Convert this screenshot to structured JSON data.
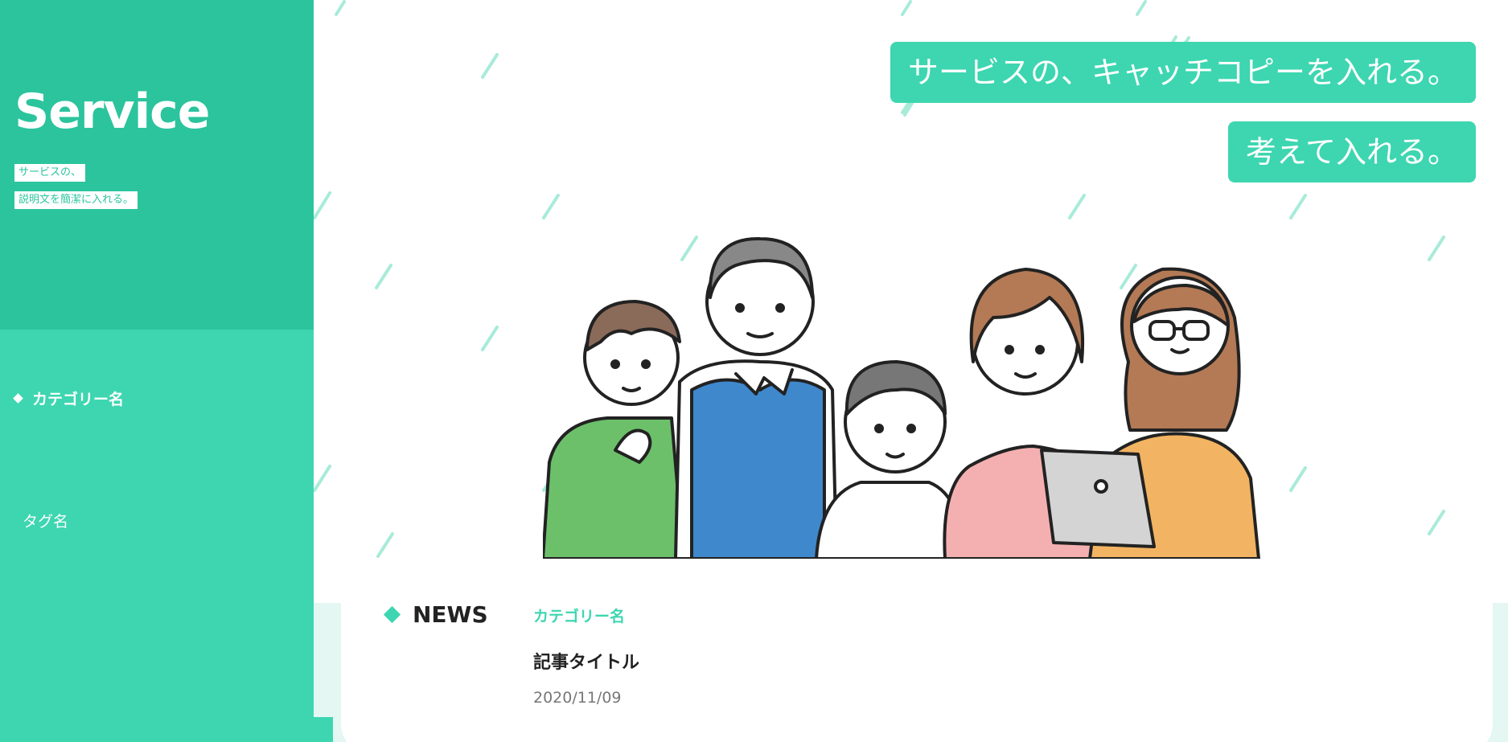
{
  "sidebar": {
    "brand": "Service",
    "description_lines": [
      "サービスの、",
      "説明文を簡潔に入れる。"
    ],
    "category_label": "カテゴリー名",
    "tag_label": "タグ名"
  },
  "hero": {
    "catch_lines": [
      "サービスの、キャッチコピーを入れる。",
      "考えて入れる。"
    ]
  },
  "news": {
    "heading": "NEWS",
    "category": "カテゴリー名",
    "article_title": "記事タイトル",
    "date": "2020/11/09"
  },
  "colors": {
    "accent": "#3dd6b0",
    "accent_dark": "#2bc49d",
    "news_band": "#e4f7f2",
    "text": "#222222"
  }
}
